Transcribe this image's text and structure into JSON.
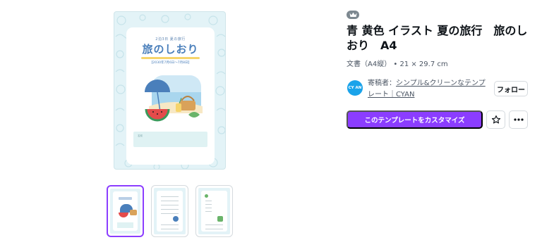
{
  "preview": {
    "kicker": "2泊3日 夏の旅行",
    "title": "旅のしおり",
    "date": "【2030年7月6日〜7月8日】",
    "box_label": "名前"
  },
  "template": {
    "title": "青 黄色 イラスト 夏の旅行　旅のしおり　A4",
    "meta": "文書（A4縦） • 21 × 29.7 cm"
  },
  "creator": {
    "prefix": "寄稿者：",
    "name": "シンプル&クリーンなテンプレート｜CYAN",
    "avatar_text": "CY AN",
    "follow_label": "フォロー"
  },
  "actions": {
    "customize_label": "このテンプレートをカスタマイズ"
  },
  "icons": {
    "badge": "crown-icon",
    "favorite": "star-icon",
    "more": "more-dots-icon"
  },
  "colors": {
    "accent": "#8b3dff",
    "avatar": "#1aa3ea",
    "preview_bg": "#e3f3f7",
    "preview_title": "#4a7fbb"
  },
  "thumbnails": {
    "selected_index": 0
  }
}
